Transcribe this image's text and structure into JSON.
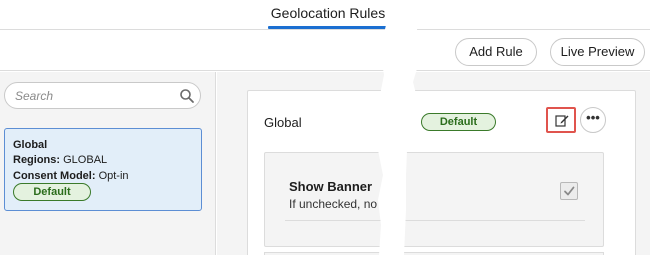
{
  "tabs": {
    "active_label": "Geolocation Rules"
  },
  "toolbar": {
    "add_rule_label": "Add Rule",
    "live_preview_label": "Live Preview"
  },
  "search": {
    "placeholder": "Search",
    "value": ""
  },
  "rules": [
    {
      "title": "Global",
      "regions_label": "Regions:",
      "regions_value": "GLOBAL",
      "consent_label": "Consent Model:",
      "consent_value": "Opt-in",
      "badge": "Default"
    }
  ],
  "detail": {
    "title": "Global",
    "badge": "Default",
    "more_label": "•••",
    "setting": {
      "title": "Show Banner",
      "description": "If unchecked, no b",
      "checked": true
    }
  },
  "colors": {
    "accent": "#1b6fd1",
    "selected_bg": "#e2eef9",
    "badge_green": "#2b6d1c",
    "highlight_red": "#e0544d"
  }
}
